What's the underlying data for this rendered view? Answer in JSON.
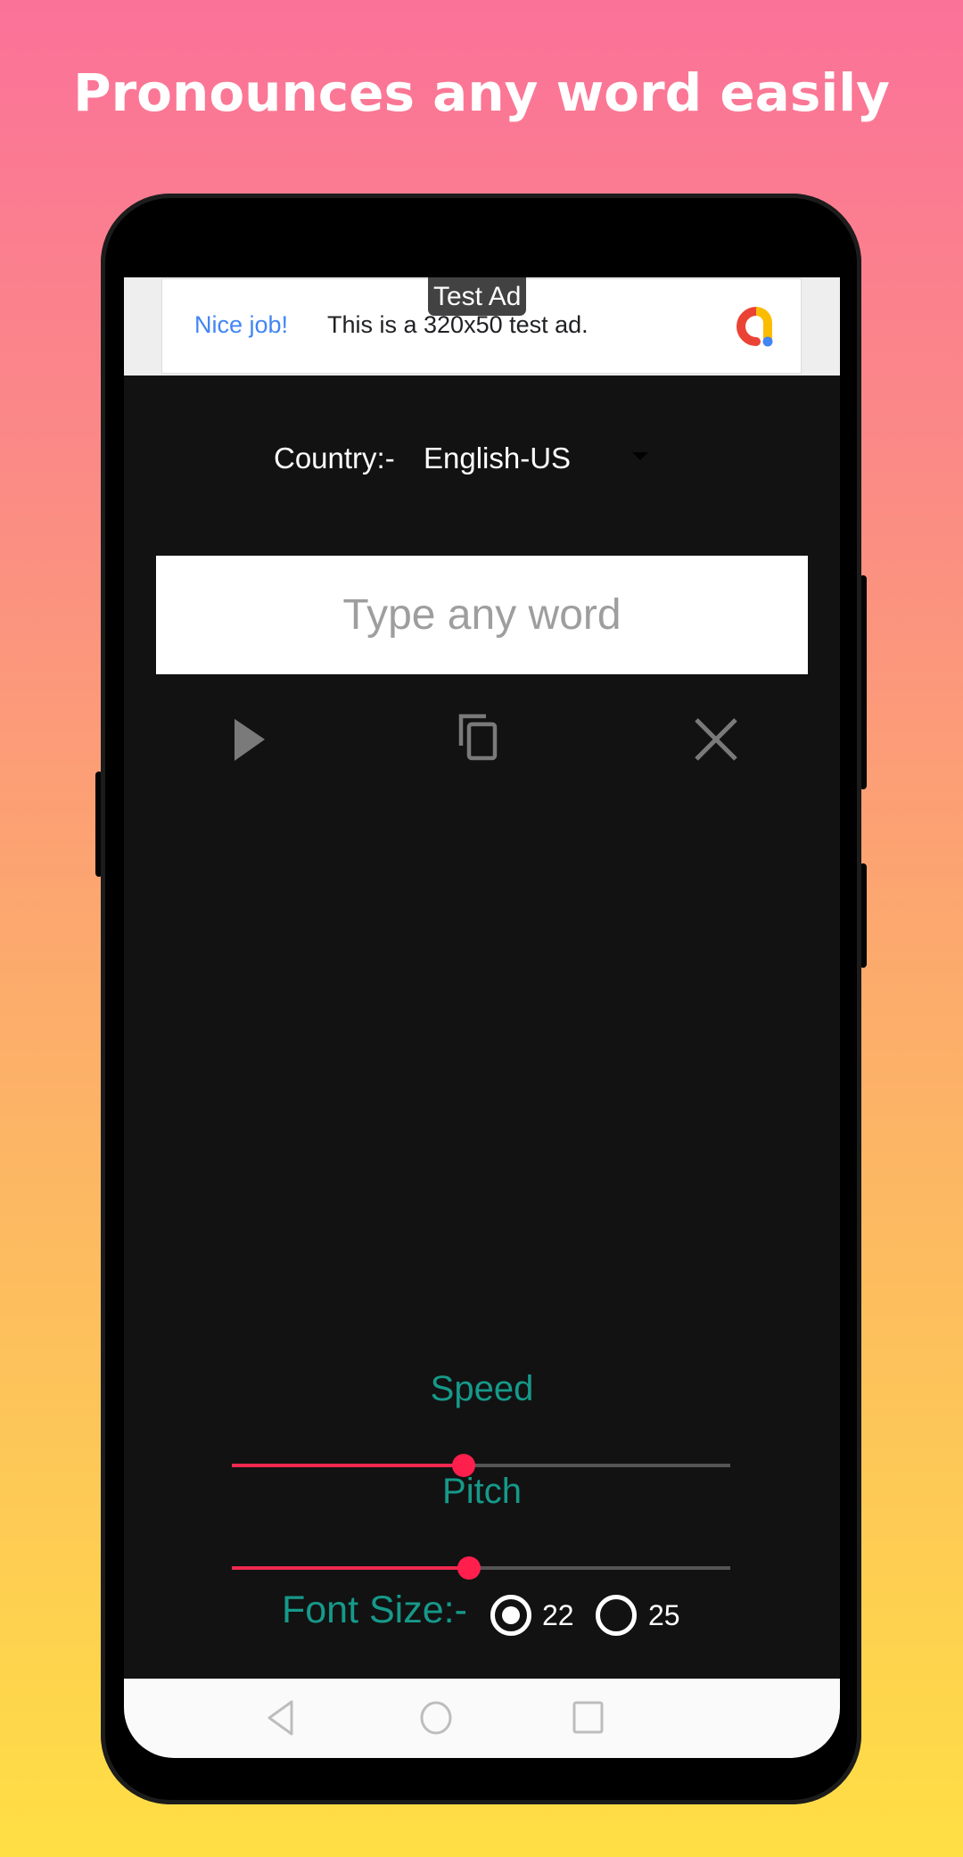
{
  "promo": {
    "headline": "Pronounces any word easily"
  },
  "ad": {
    "badge": "Test Ad",
    "nice_text": "Nice job!",
    "body_text": "This is a 320x50 test ad.",
    "logo_icon": "admob-logo-icon",
    "nice_color": "#4285f4"
  },
  "country": {
    "label": "Country:-",
    "selected": "English-US"
  },
  "input": {
    "placeholder": "Type any word",
    "value": ""
  },
  "actions": {
    "play_icon": "play-icon",
    "copy_icon": "copy-icon",
    "clear_icon": "close-icon"
  },
  "sliders": {
    "speed": {
      "label": "Speed",
      "value_fraction": 0.465
    },
    "pitch": {
      "label": "Pitch",
      "value_fraction": 0.475
    }
  },
  "font_size": {
    "label": "Font Size:-",
    "options": [
      "22",
      "25"
    ],
    "selected": "22"
  },
  "colors": {
    "accent_teal": "#16998a",
    "slider_red": "#ff1f4d",
    "app_background": "#121212"
  },
  "navbar": {
    "back_icon": "back-icon",
    "home_icon": "home-icon",
    "recents_icon": "recents-icon"
  }
}
